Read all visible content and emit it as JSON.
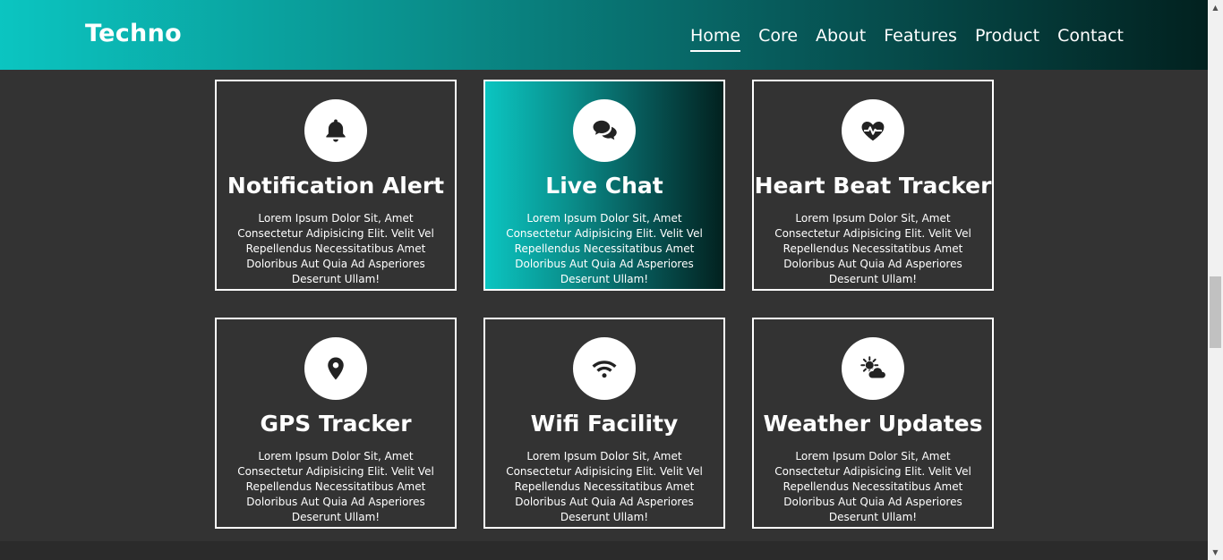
{
  "header": {
    "brand": "Techno",
    "nav": [
      {
        "label": "Home",
        "active": true
      },
      {
        "label": "Core"
      },
      {
        "label": "About"
      },
      {
        "label": "Features"
      },
      {
        "label": "Product"
      },
      {
        "label": "Contact"
      }
    ]
  },
  "cards": [
    {
      "icon": "bell-icon",
      "title": "Notification Alert",
      "text": "Lorem Ipsum Dolor Sit, Amet Consectetur Adipisicing Elit. Velit Vel Repellendus Necessitatibus Amet Doloribus Aut Quia Ad Asperiores Deserunt Ullam!"
    },
    {
      "icon": "chat-bubbles-icon",
      "title": "Live Chat",
      "text": "Lorem Ipsum Dolor Sit, Amet Consectetur Adipisicing Elit. Velit Vel Repellendus Necessitatibus Amet Doloribus Aut Quia Ad Asperiores Deserunt Ullam!",
      "highlighted": true
    },
    {
      "icon": "heart-pulse-icon",
      "title": "Heart Beat Tracker",
      "text": "Lorem Ipsum Dolor Sit, Amet Consectetur Adipisicing Elit. Velit Vel Repellendus Necessitatibus Amet Doloribus Aut Quia Ad Asperiores Deserunt Ullam!"
    },
    {
      "icon": "map-pin-icon",
      "title": "GPS Tracker",
      "text": "Lorem Ipsum Dolor Sit, Amet Consectetur Adipisicing Elit. Velit Vel Repellendus Necessitatibus Amet Doloribus Aut Quia Ad Asperiores Deserunt Ullam!"
    },
    {
      "icon": "wifi-icon",
      "title": "Wifi Facility",
      "text": "Lorem Ipsum Dolor Sit, Amet Consectetur Adipisicing Elit. Velit Vel Repellendus Necessitatibus Amet Doloribus Aut Quia Ad Asperiores Deserunt Ullam!"
    },
    {
      "icon": "sun-cloud-icon",
      "title": "Weather Updates",
      "text": "Lorem Ipsum Dolor Sit, Amet Consectetur Adipisicing Elit. Velit Vel Repellendus Necessitatibus Amet Doloribus Aut Quia Ad Asperiores Deserunt Ullam!"
    }
  ],
  "colors": {
    "background": "#333333",
    "gradient_start": "#0bc5c1",
    "gradient_end": "#02211f",
    "card_border": "#ffffff",
    "text": "#ffffff"
  }
}
